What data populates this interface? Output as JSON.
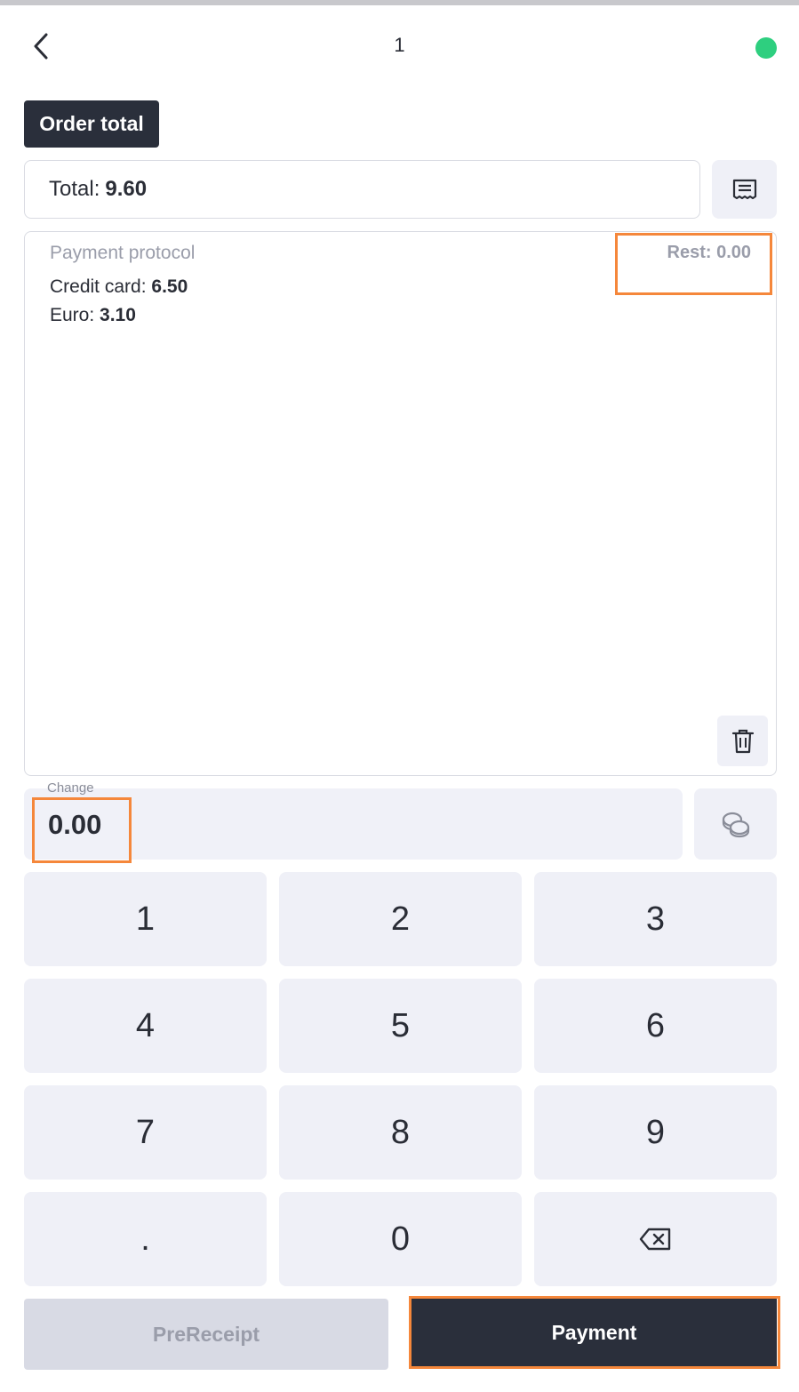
{
  "header": {
    "title": "1",
    "back_icon": "chevron-left-icon",
    "status_color": "#2ecf7f"
  },
  "order_total": {
    "chip_label": "Order total",
    "total_label": "Total:",
    "total_value": "9.60",
    "receipt_icon": "receipt-icon"
  },
  "protocol": {
    "title": "Payment protocol",
    "rest": "Rest: 0.00",
    "payments": [
      {
        "label": "Credit card:",
        "amount": "6.50"
      },
      {
        "label": "Euro:",
        "amount": "3.10"
      }
    ],
    "trash_icon": "trash-icon"
  },
  "change": {
    "label": "Change",
    "value": "0.00",
    "coins_icon": "coins-icon"
  },
  "keypad": {
    "keys": [
      "1",
      "2",
      "3",
      "4",
      "5",
      "6",
      "7",
      "8",
      "9",
      ".",
      "0",
      "⌫"
    ]
  },
  "actions": {
    "prereceipt_label": "PreReceipt",
    "payment_label": "Payment"
  },
  "colors": {
    "accent_dark": "#2a2f3b",
    "highlight": "#f5873b",
    "key_bg": "#eff0f7"
  }
}
